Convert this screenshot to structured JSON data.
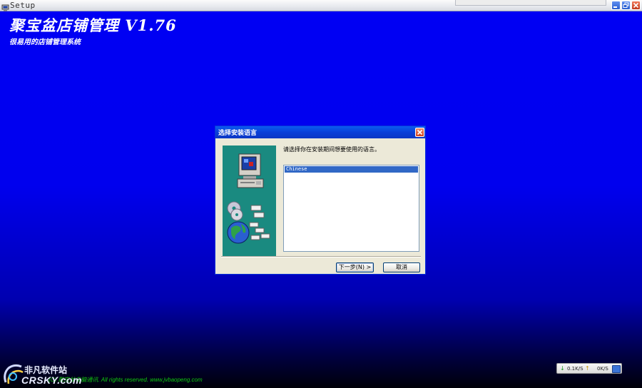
{
  "window": {
    "title": "Setup",
    "icon": "setup-app-icon",
    "controls": [
      "minimize-icon",
      "restore-icon",
      "close-icon"
    ]
  },
  "app": {
    "title": "聚宝盆店铺管理 V1.76",
    "subtitle": "很易用的店铺管理系统"
  },
  "dialog": {
    "title": "选择安装语言",
    "prompt": "请选择你在安装期间想要使用的语言。",
    "languages": [
      "Chinese"
    ],
    "selected_language": "Chinese",
    "next_button": "下一步(N) >",
    "cancel_button": "取消"
  },
  "footer": {
    "copyright": "(C) 聚宝盆电脑通讯. All rights reserved. www.jvbaopeng.com",
    "watermark_cn": "非凡软件站",
    "watermark_en": "CRSKY.com"
  },
  "net_meter": {
    "download": "0.1K/S",
    "upload": "0K/S"
  },
  "colors": {
    "desktop_blue": "#0000f4",
    "dialog_title_blue": "#0a3fd8",
    "side_panel_teal": "#1a8a80",
    "selection": "#3168c6",
    "copyright_green": "#11c811"
  }
}
